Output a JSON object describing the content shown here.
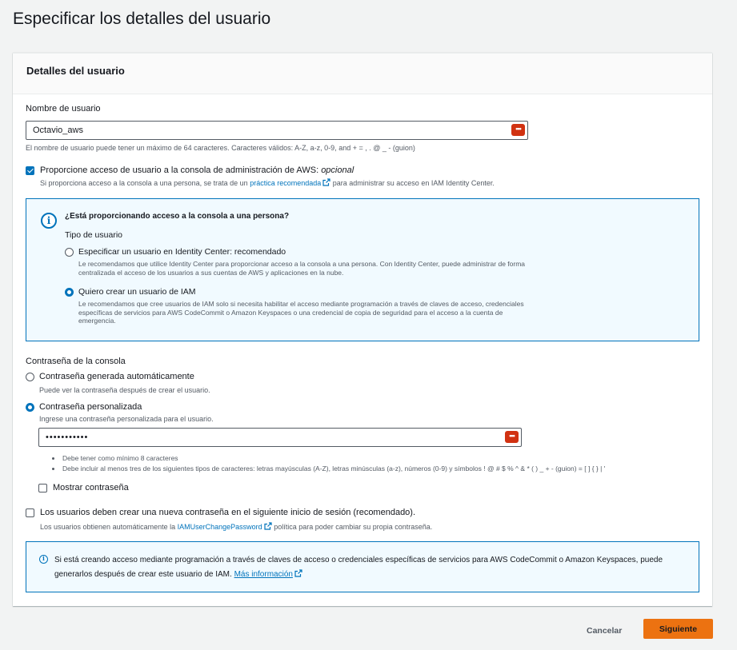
{
  "page": {
    "title": "Especificar los detalles del usuario"
  },
  "panel": {
    "title": "Detalles del usuario"
  },
  "username": {
    "label": "Nombre de usuario",
    "value": "Octavio_aws",
    "hint": "El nombre de usuario puede tener un máximo de 64 caracteres. Caracteres válidos: A-Z, a-z, 0-9, and + = , . @ _ - (guion)"
  },
  "console_access": {
    "checked": true,
    "label": "Proporcione acceso de usuario a la consola de administración de AWS:",
    "optional": "opcional",
    "desc_before": "Si proporciona acceso a la consola a una persona, se trata de un",
    "desc_link": "práctica recomendada",
    "desc_after": "para administrar su acceso en IAM Identity Center."
  },
  "person_box": {
    "title": "¿Está proporcionando acceso a la consola a una persona?",
    "user_type_label": "Tipo de usuario",
    "options": [
      {
        "label": "Especificar un usuario en Identity Center: recomendado",
        "desc": "Le recomendamos que utilice Identity Center para proporcionar acceso a la consola a una persona. Con Identity Center, puede administrar de forma centralizada el acceso de los usuarios a sus cuentas de AWS y aplicaciones en la nube.",
        "selected": false
      },
      {
        "label": "Quiero crear un usuario de IAM",
        "desc": "Le recomendamos que cree usuarios de IAM solo si necesita habilitar el acceso mediante programación a través de claves de acceso, credenciales específicas de servicios para AWS CodeCommit o Amazon Keyspaces o una credencial de copia de seguridad para el acceso a la cuenta de emergencia.",
        "selected": true
      }
    ]
  },
  "password": {
    "label": "Contraseña de la consola",
    "options": [
      {
        "label": "Contraseña generada automáticamente",
        "desc": "Puede ver la contraseña después de crear el usuario.",
        "selected": false
      },
      {
        "label": "Contraseña personalizada",
        "desc": "Ingrese una contraseña personalizada para el usuario.",
        "selected": true
      }
    ],
    "value": "•••••••••••",
    "rules": [
      "Debe tener como mínimo 8 caracteres",
      "Debe incluir al menos tres de los siguientes tipos de caracteres: letras mayúsculas (A-Z), letras minúsculas (a-z), números (0-9) y símbolos ! @ # $ % ^ & * ( ) _ + - (guion) = [ ] { } | '"
    ],
    "show_label": "Mostrar contraseña",
    "show_checked": false
  },
  "reset": {
    "checked": false,
    "label": "Los usuarios deben crear una nueva contraseña en el siguiente inicio de sesión (recomendado).",
    "desc_before": "Los usuarios obtienen automáticamente la",
    "desc_link": "IAMUserChangePassword",
    "desc_after": "política para poder cambiar su propia contraseña."
  },
  "info": {
    "text": "Si está creando acceso mediante programación a través de claves de acceso o credenciales específicas de servicios para AWS CodeCommit o Amazon Keyspaces, puede generarlos después de crear este usuario de IAM.",
    "link": "Más información"
  },
  "footer": {
    "cancel": "Cancelar",
    "next": "Siguiente"
  },
  "icons": {
    "password_manager": "•••",
    "info": "i"
  },
  "colors": {
    "accent": "#0073bb",
    "primary_button": "#ec7211",
    "password_manager_icon": "#d13212"
  }
}
